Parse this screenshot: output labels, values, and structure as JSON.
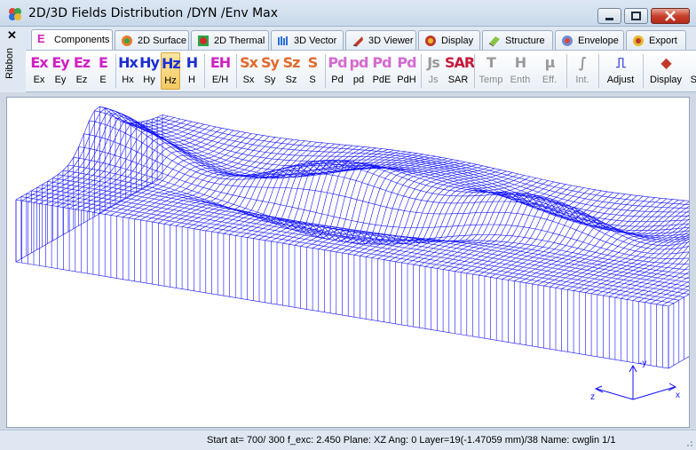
{
  "window": {
    "title": "2D/3D Fields Distribution /DYN /Env Max"
  },
  "ribbon": {
    "close_glyph": "✕",
    "label": "Ribbon"
  },
  "tabs": [
    {
      "label": "Components",
      "icon": "E",
      "icon_color": "#d11fc4"
    },
    {
      "label": "2D Surface",
      "icon": "surface-icon"
    },
    {
      "label": "2D Thermal",
      "icon": "thermal-icon"
    },
    {
      "label": "3D Vector",
      "icon": "vector-icon"
    },
    {
      "label": "3D Viewer",
      "icon": "viewer-icon"
    },
    {
      "label": "Display",
      "icon": "display-icon"
    },
    {
      "label": "Structure",
      "icon": "structure-icon"
    },
    {
      "label": "Envelope",
      "icon": "envelope-icon"
    },
    {
      "label": "Export",
      "icon": "export-icon"
    }
  ],
  "toolbar": {
    "buttons": [
      {
        "big": "Ex",
        "label": "Ex",
        "color": "#d11fc4"
      },
      {
        "big": "Ey",
        "label": "Ey",
        "color": "#d11fc4"
      },
      {
        "big": "Ez",
        "label": "Ez",
        "color": "#d11fc4"
      },
      {
        "big": "E",
        "label": "E",
        "color": "#d11fc4"
      },
      {
        "big": "Hx",
        "label": "Hx",
        "color": "#1c2fd0"
      },
      {
        "big": "Hy",
        "label": "Hy",
        "color": "#1c2fd0"
      },
      {
        "big": "Hz",
        "label": "Hz",
        "color": "#1c2fd0"
      },
      {
        "big": "H",
        "label": "H",
        "color": "#1c2fd0"
      },
      {
        "big": "EH",
        "label": "E/H",
        "color": "#d11fc4"
      },
      {
        "big": "Sx",
        "label": "Sx",
        "color": "#e06a2c"
      },
      {
        "big": "Sy",
        "label": "Sy",
        "color": "#e06a2c"
      },
      {
        "big": "Sz",
        "label": "Sz",
        "color": "#e06a2c"
      },
      {
        "big": "S",
        "label": "S",
        "color": "#e06a2c"
      },
      {
        "big": "Pd",
        "label": "Pd",
        "color": "#d46ad0"
      },
      {
        "big": "pd",
        "label": "pd",
        "color": "#d46ad0"
      },
      {
        "big": "Pd",
        "label": "PdE",
        "color": "#d46ad0"
      },
      {
        "big": "Pd",
        "label": "PdH",
        "color": "#d46ad0"
      },
      {
        "big": "Js",
        "label": "Js",
        "color": "#9a9a9a"
      },
      {
        "big": "SAR",
        "label": "SAR",
        "color": "#c41a3c"
      },
      {
        "big": "T",
        "label": "Temp",
        "color": "#9a9a9a"
      },
      {
        "big": "H",
        "label": "Enth",
        "color": "#9a9a9a"
      },
      {
        "big": "μ",
        "label": "Eff.",
        "color": "#9a9a9a"
      },
      {
        "big": "∫",
        "label": "Int.",
        "color": "#9a9a9a"
      },
      {
        "big": "⎍",
        "label": "Adjust",
        "color": "#1c2fd0"
      },
      {
        "big": "◆",
        "label": "Display",
        "color": "#c0392b"
      },
      {
        "big": "◆",
        "label": "Structure",
        "color": "#27a844"
      }
    ],
    "selected": "Hz"
  },
  "axes": {
    "y_label": "-y",
    "x_label": "x",
    "z_label": "z"
  },
  "status": {
    "text": "Start at= 700/ 300  f_exc:  2.450  Plane: XZ  Ang:   0  Layer=19(-1.47059 mm)/38  Name: cwglin 1/1"
  },
  "colors": {
    "mesh": "#1010ff",
    "accent": "#f6c960"
  }
}
